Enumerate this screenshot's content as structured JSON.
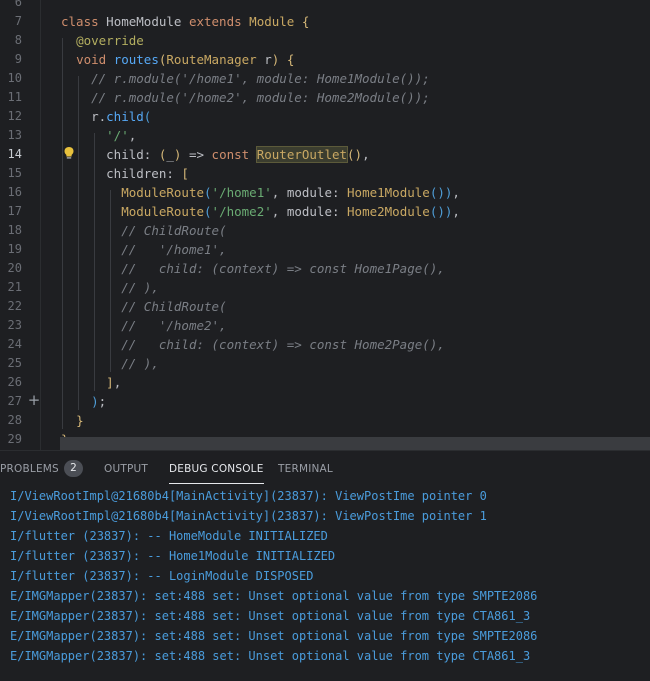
{
  "editor": {
    "lines": [
      {
        "n": "6",
        "html": ""
      },
      {
        "n": "7",
        "html": "<span class=\"kw\">class</span> HomeModule <span class=\"kw\">extends</span> <span class=\"cls\">Module</span> <span class=\"pw\">{</span>"
      },
      {
        "n": "8",
        "html": "  <span class=\"ann\">@override</span>"
      },
      {
        "n": "9",
        "html": "  <span class=\"kw\">void</span> <span class=\"fn\">routes</span><span class=\"pw\">(</span><span class=\"cls\">RouteManager</span> r<span class=\"pw\">)</span> <span class=\"pw\">{</span>"
      },
      {
        "n": "10",
        "html": "    <span class=\"cmt\">// r.module('/home1', module: Home1Module());</span>"
      },
      {
        "n": "11",
        "html": "    <span class=\"cmt\">// r.module('/home2', module: Home2Module());</span>"
      },
      {
        "n": "12",
        "html": "    r.<span class=\"fn\">child</span><span class=\"pb\">(</span>"
      },
      {
        "n": "13",
        "html": "      <span class=\"str\">'/'</span>,"
      },
      {
        "n": "14",
        "html": "      child: <span class=\"pw\">(</span>_<span class=\"pw\">)</span> => <span class=\"kw\">const</span> <span class=\"cls hl\">RouterOutlet</span><span class=\"pw\">()</span>,"
      },
      {
        "n": "15",
        "html": "      children: <span class=\"pw\">[</span>"
      },
      {
        "n": "16",
        "html": "        <span class=\"cls\">ModuleRoute</span><span class=\"pb\">(</span><span class=\"str\">'/home1'</span>, module: <span class=\"cls\">Home1Module</span><span class=\"pb\">()</span><span class=\"pb\">)</span>,"
      },
      {
        "n": "17",
        "html": "        <span class=\"cls\">ModuleRoute</span><span class=\"pb\">(</span><span class=\"str\">'/home2'</span>, module: <span class=\"cls\">Home2Module</span><span class=\"pb\">()</span><span class=\"pb\">)</span>,"
      },
      {
        "n": "18",
        "html": "        <span class=\"cmt\">// ChildRoute(</span>"
      },
      {
        "n": "19",
        "html": "        <span class=\"cmt\">//   '/home1',</span>"
      },
      {
        "n": "20",
        "html": "        <span class=\"cmt\">//   child: (context) => const Home1Page(),</span>"
      },
      {
        "n": "21",
        "html": "        <span class=\"cmt\">// ),</span>"
      },
      {
        "n": "22",
        "html": "        <span class=\"cmt\">// ChildRoute(</span>"
      },
      {
        "n": "23",
        "html": "        <span class=\"cmt\">//   '/home2',</span>"
      },
      {
        "n": "24",
        "html": "        <span class=\"cmt\">//   child: (context) => const Home2Page(),</span>"
      },
      {
        "n": "25",
        "html": "        <span class=\"cmt\">// ),</span>"
      },
      {
        "n": "26",
        "html": "      <span class=\"pw\">]</span>,"
      },
      {
        "n": "27",
        "html": "    <span class=\"pb\">)</span>;"
      },
      {
        "n": "28",
        "html": "  <span class=\"pw\">}</span>"
      },
      {
        "n": "29",
        "html": "<span class=\"pw\">}</span>"
      }
    ],
    "current_line": "14"
  },
  "panel": {
    "tabs": {
      "problems": "PROBLEMS",
      "problems_count": "2",
      "output": "OUTPUT",
      "debug_console": "DEBUG CONSOLE",
      "terminal": "TERMINAL"
    },
    "console_lines": [
      "I/ViewRootImpl@21680b4[MainActivity](23837): ViewPostIme pointer 0",
      "I/ViewRootImpl@21680b4[MainActivity](23837): ViewPostIme pointer 1",
      "I/flutter (23837): -- HomeModule INITIALIZED",
      "I/flutter (23837): -- Home1Module INITIALIZED",
      "I/flutter (23837): -- LoginModule DISPOSED",
      "E/IMGMapper(23837): set:488 set: Unset optional value from type SMPTE2086",
      "E/IMGMapper(23837): set:488 set: Unset optional value from type CTA861_3",
      "E/IMGMapper(23837): set:488 set: Unset optional value from type SMPTE2086",
      "E/IMGMapper(23837): set:488 set: Unset optional value from type CTA861_3"
    ]
  },
  "icons": {
    "bulb": "lightbulb-icon",
    "plus": "add-icon"
  },
  "colors": {
    "background": "#1e1f22",
    "keyword": "#cf8e6d",
    "string": "#6aab73",
    "comment": "#7a7e85",
    "console_text": "#4a9cdc"
  }
}
